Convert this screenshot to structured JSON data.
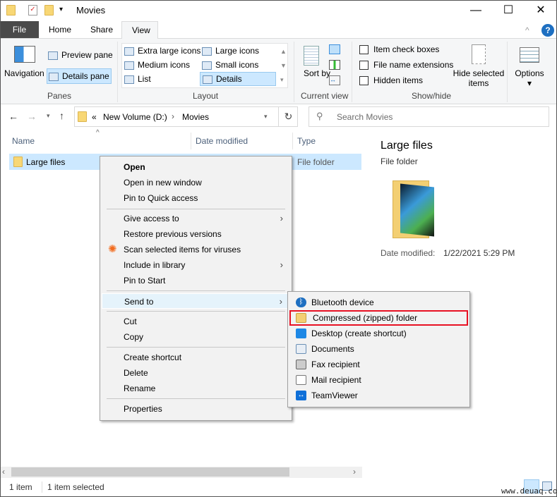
{
  "window": {
    "title": "Movies",
    "minimize": "—",
    "maximize": "☐",
    "close": "✕"
  },
  "tabs": [
    {
      "label": "File"
    },
    {
      "label": "Home"
    },
    {
      "label": "Share"
    },
    {
      "label": "View"
    }
  ],
  "ribbon": {
    "panes": {
      "nav_pane": "Navigation pane",
      "preview_pane": "Preview pane",
      "details_pane": "Details pane",
      "group": "Panes"
    },
    "layout": {
      "items": [
        "Extra large icons",
        "Large icons",
        "Medium icons",
        "Small icons",
        "List",
        "Details"
      ],
      "selected": "Details",
      "group": "Layout"
    },
    "current_view": {
      "sort_by": "Sort by",
      "group": "Current view"
    },
    "show_hide": {
      "item_check_boxes": "Item check boxes",
      "file_name_extensions": "File name extensions",
      "hidden_items": "Hidden items",
      "hide_selected": "Hide selected items",
      "group": "Show/hide"
    },
    "options": "Options",
    "help": "?"
  },
  "address": {
    "prefix": "«",
    "path": [
      "New Volume (D:)",
      "Movies"
    ],
    "search_placeholder": "Search Movies"
  },
  "columns": [
    "Name",
    "Date modified",
    "Type"
  ],
  "files": [
    {
      "name": "Large files",
      "type": "File folder"
    }
  ],
  "preview": {
    "title": "Large files",
    "subtitle": "File folder",
    "date_label": "Date modified:",
    "date_value": "1/22/2021 5:29 PM"
  },
  "context_menu": {
    "items": [
      "Open",
      "Open in new window",
      "Pin to Quick access",
      "Give access to",
      "Restore previous versions",
      "Scan selected items for viruses",
      "Include in library",
      "Pin to Start",
      "Send to",
      "Cut",
      "Copy",
      "Create shortcut",
      "Delete",
      "Rename",
      "Properties"
    ],
    "highlighted": "Send to"
  },
  "send_to": {
    "items": [
      "Bluetooth device",
      "Compressed (zipped) folder",
      "Desktop (create shortcut)",
      "Documents",
      "Fax recipient",
      "Mail recipient",
      "TeamViewer"
    ],
    "outlined": "Compressed (zipped) folder",
    "outline_color": "#e81123"
  },
  "status": {
    "count": "1 item",
    "selected": "1 item selected"
  },
  "watermark": "www.deuaq.com",
  "colors": {
    "file_tab": "#4a4a4a",
    "selection": "#cce8ff",
    "accent": "#0078d7"
  }
}
